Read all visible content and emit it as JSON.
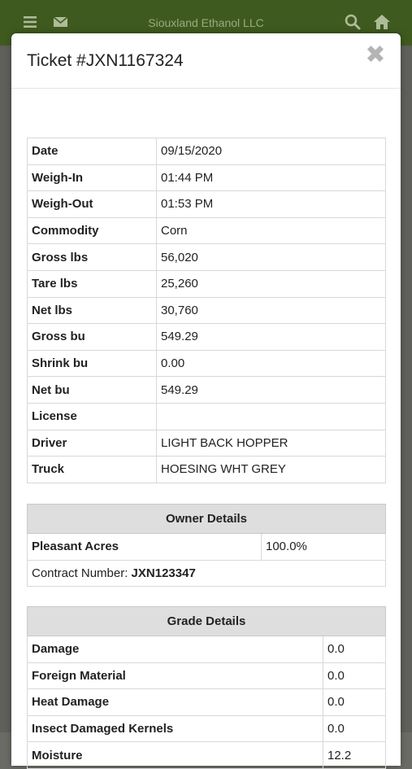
{
  "app": {
    "title": "Siouxland Ethanol LLC"
  },
  "icons": {
    "menu": "menu-icon",
    "mail": "mail-icon",
    "search": "search-icon",
    "home": "home-icon",
    "close": "close-icon"
  },
  "colors": {
    "header_bg": "#3f5a1e",
    "table_header_bg": "#dedede"
  },
  "modal": {
    "title": "Ticket #JXN1167324",
    "close_label": "✖"
  },
  "ticket": {
    "rows": [
      {
        "label": "Date",
        "value": "09/15/2020"
      },
      {
        "label": "Weigh-In",
        "value": "01:44 PM"
      },
      {
        "label": "Weigh-Out",
        "value": "01:53 PM"
      },
      {
        "label": "Commodity",
        "value": "Corn"
      },
      {
        "label": "Gross lbs",
        "value": "56,020"
      },
      {
        "label": "Tare lbs",
        "value": "25,260"
      },
      {
        "label": "Net lbs",
        "value": "30,760"
      },
      {
        "label": "Gross bu",
        "value": "549.29"
      },
      {
        "label": "Shrink bu",
        "value": "0.00"
      },
      {
        "label": "Net bu",
        "value": "549.29"
      },
      {
        "label": "License",
        "value": ""
      },
      {
        "label": "Driver",
        "value": "LIGHT BACK HOPPER"
      },
      {
        "label": "Truck",
        "value": "HOESING WHT GREY"
      }
    ]
  },
  "owner": {
    "header": "Owner Details",
    "name": "Pleasant Acres",
    "share": "100.0%",
    "contract_label": "Contract Number:",
    "contract_number": "JXN123347"
  },
  "grade": {
    "header": "Grade Details",
    "rows": [
      {
        "label": "Damage",
        "value": "0.0"
      },
      {
        "label": "Foreign Material",
        "value": "0.0"
      },
      {
        "label": "Heat Damage",
        "value": "0.0"
      },
      {
        "label": "Insect Damaged Kernels",
        "value": "0.0"
      },
      {
        "label": "Moisture",
        "value": "12.2"
      }
    ]
  }
}
